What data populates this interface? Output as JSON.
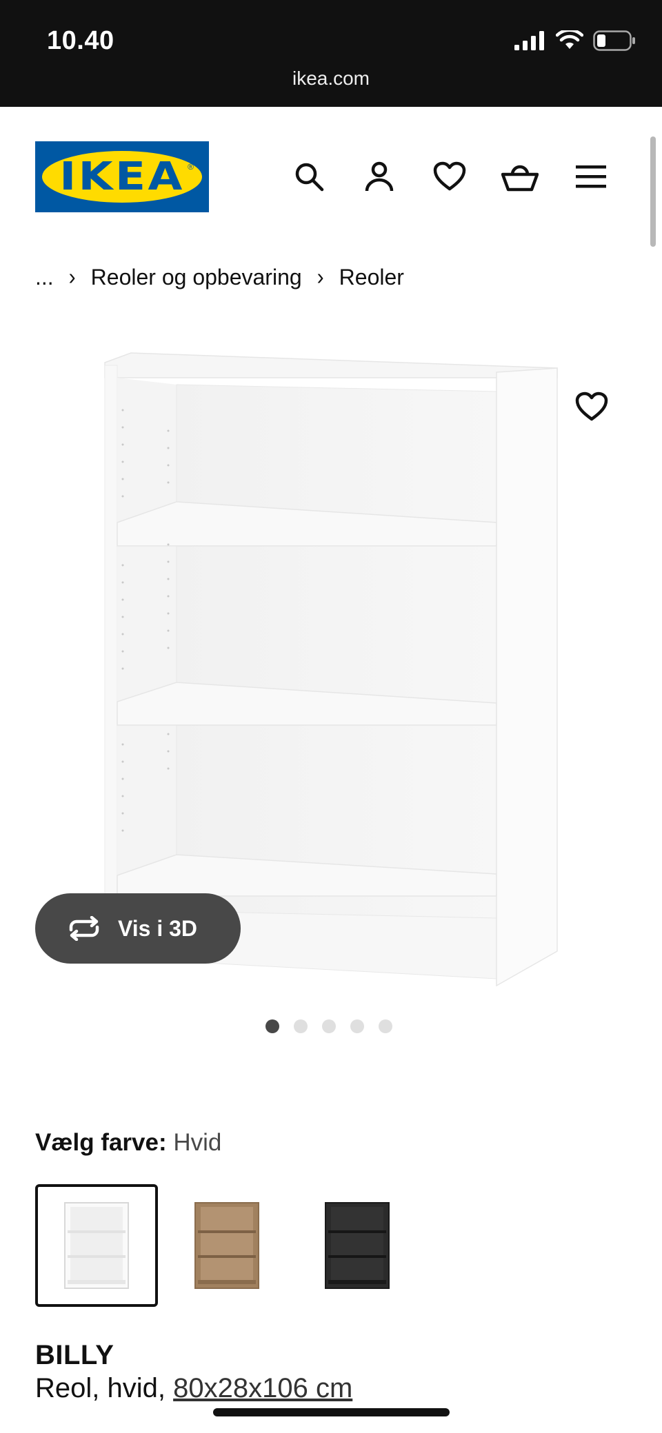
{
  "status_bar": {
    "time": "10.40",
    "url": "ikea.com"
  },
  "header": {
    "logo_text": "IKEA",
    "icons": [
      "search-icon",
      "account-icon",
      "favourites-icon",
      "basket-icon",
      "menu-icon"
    ]
  },
  "breadcrumb": {
    "items": [
      "...",
      "Reoler og opbevaring",
      "Reoler"
    ],
    "separator": "›"
  },
  "gallery": {
    "vis3d_label": "Vis i 3D",
    "dot_count": 5,
    "active_dot": 1
  },
  "color_selector": {
    "label": "Vælg farve:",
    "selected": "Hvid",
    "options": [
      {
        "name": "white",
        "color": "#f5f5f5",
        "selected": true
      },
      {
        "name": "wood",
        "color": "#9b7a57",
        "selected": false
      },
      {
        "name": "black",
        "color": "#262626",
        "selected": false
      }
    ]
  },
  "product": {
    "name": "BILLY",
    "description": "Reol, hvid,",
    "dimensions": "80x28x106 cm"
  },
  "colors": {
    "status_bar_bg": "#111111",
    "ikea_blue": "#0058a3",
    "ikea_yellow": "#ffdb00",
    "pill_bg": "#484848"
  }
}
